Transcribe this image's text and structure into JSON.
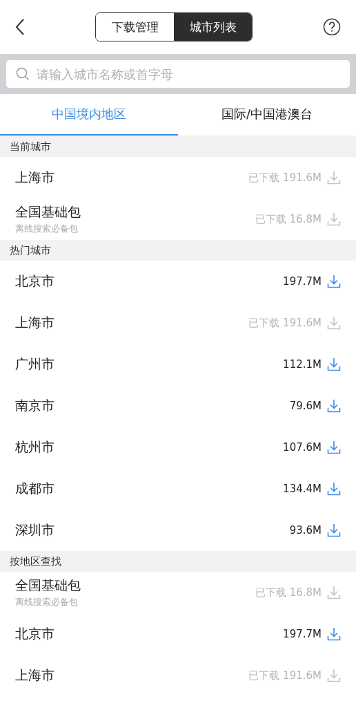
{
  "segments": [
    {
      "label": "下载管理",
      "selected": false
    },
    {
      "label": "城市列表",
      "selected": true
    }
  ],
  "search": {
    "placeholder": "请输入城市名称或首字母"
  },
  "tabs": [
    {
      "label": "中国境内地区",
      "selected": true
    },
    {
      "label": "国际/中国港澳台",
      "selected": false
    }
  ],
  "sections": [
    {
      "title": "当前城市",
      "rows": [
        {
          "name": "上海市",
          "size": "已下载 191.6M",
          "downloaded": true
        },
        {
          "name": "全国基础包",
          "subtitle": "离线搜索必备包",
          "size": "已下载 16.8M",
          "downloaded": true
        }
      ]
    },
    {
      "title": "热门城市",
      "rows": [
        {
          "name": "北京市",
          "size": "197.7M",
          "downloaded": false
        },
        {
          "name": "上海市",
          "size": "已下载 191.6M",
          "downloaded": true
        },
        {
          "name": "广州市",
          "size": "112.1M",
          "downloaded": false
        },
        {
          "name": "南京市",
          "size": "79.6M",
          "downloaded": false
        },
        {
          "name": "杭州市",
          "size": "107.6M",
          "downloaded": false
        },
        {
          "name": "成都市",
          "size": "134.4M",
          "downloaded": false
        },
        {
          "name": "深圳市",
          "size": "93.6M",
          "downloaded": false
        }
      ]
    },
    {
      "title": "按地区查找",
      "rows": [
        {
          "name": "全国基础包",
          "subtitle": "离线搜索必备包",
          "size": "已下载 16.8M",
          "downloaded": true
        },
        {
          "name": "北京市",
          "size": "197.7M",
          "downloaded": false
        },
        {
          "name": "上海市",
          "size": "已下载 191.6M",
          "downloaded": true
        }
      ]
    }
  ]
}
